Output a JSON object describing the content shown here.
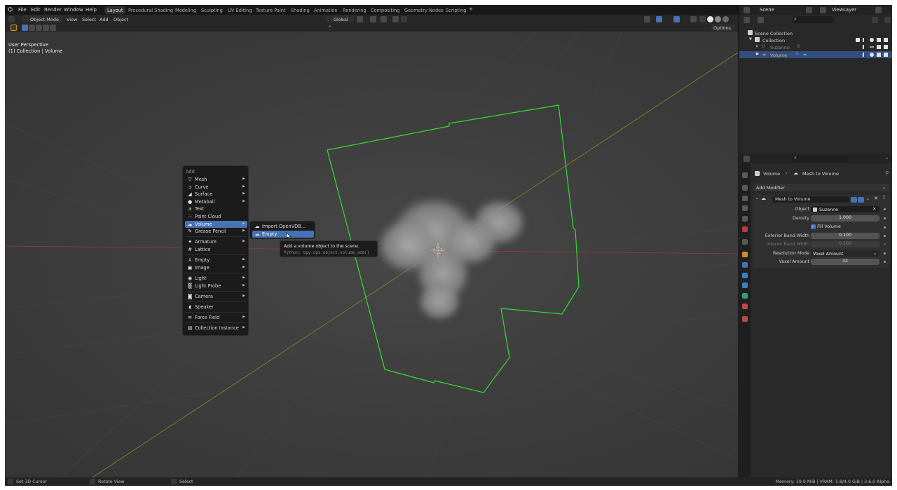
{
  "topbar": {
    "menus": [
      "File",
      "Edit",
      "Render",
      "Window",
      "Help"
    ],
    "workspaces": [
      "Layout",
      "Procedural Shading",
      "Modeling",
      "Sculpting",
      "UV Editing",
      "Texture Paint",
      "Shading",
      "Animation",
      "Rendering",
      "Compositing",
      "Geometry Nodes",
      "Scripting"
    ],
    "active_workspace": "Layout",
    "add_tab": "+",
    "scene": "Scene",
    "view_layer": "ViewLayer"
  },
  "viewport_header": {
    "mode": "Object Mode",
    "view": "View",
    "select": "Select",
    "add": "Add",
    "object": "Object",
    "orientation": "Global",
    "options": "Options"
  },
  "viewport": {
    "perspective": "User Perspective",
    "collection": "(1) Collection | Volume"
  },
  "add_menu": {
    "title": "Add",
    "items": [
      {
        "label": "Mesh",
        "icon": "▽",
        "sub": true
      },
      {
        "label": "Curve",
        "icon": "ↄ",
        "sub": true
      },
      {
        "label": "Surface",
        "icon": "◢",
        "sub": true
      },
      {
        "label": "Metaball",
        "icon": "●",
        "sub": true
      },
      {
        "label": "Text",
        "icon": "a",
        "sub": false
      },
      {
        "label": "Point Cloud",
        "icon": "⁘",
        "sub": false
      },
      {
        "label": "Volume",
        "icon": "☁",
        "sub": true
      },
      {
        "label": "Grease Pencil",
        "icon": "✎",
        "sub": true
      },
      {
        "label": "Armature",
        "icon": "✦",
        "sub": true
      },
      {
        "label": "Lattice",
        "icon": "#",
        "sub": false
      },
      {
        "label": "Empty",
        "icon": "⅄",
        "sub": true
      },
      {
        "label": "Image",
        "icon": "▣",
        "sub": true
      },
      {
        "label": "Light",
        "icon": "◉",
        "sub": true
      },
      {
        "label": "Light Probe",
        "icon": "▒",
        "sub": true
      },
      {
        "label": "Camera",
        "icon": "◙",
        "sub": true
      },
      {
        "label": "Speaker",
        "icon": "◖",
        "sub": false
      },
      {
        "label": "Force Field",
        "icon": "≋",
        "sub": true
      },
      {
        "label": "Collection Instance",
        "icon": "▤",
        "sub": true
      }
    ],
    "submenu": [
      {
        "label": "Import OpenVDB...",
        "icon": "☁"
      },
      {
        "label": "Empty",
        "icon": "☁"
      }
    ]
  },
  "tooltip": {
    "text": "Add a volume object to the scene.",
    "python": "Python: bpy.ops.object.volume_add()"
  },
  "statusbar": {
    "set_cursor": "Set 3D Cursor",
    "rotate": "Rotate View",
    "select": "Select",
    "memory": "Memory: 19.9 MiB | VRAM: 1.8/4.0 GiB | 3.6.0 Alpha"
  },
  "outliner": {
    "scene_collection": "Scene Collection",
    "collection": "Collection",
    "objects": [
      "Suzanne",
      "Volume"
    ]
  },
  "properties": {
    "breadcrumb_object": "Volume",
    "breadcrumb_modifier": "Mesh to Volume",
    "add_modifier": "Add Modifier",
    "modifier_name": "Mesh to Volume",
    "object_label": "Object",
    "object_value": "Suzanne",
    "density_label": "Density",
    "density_value": "1.000",
    "fill_volume": "Fill Volume",
    "ext_band_label": "Exterior Band Width",
    "ext_band_value": "0.100",
    "int_band_label": "Interior Band Width",
    "int_band_value": "0.100",
    "res_mode_label": "Resolution Mode",
    "res_mode_value": "Voxel Amount",
    "voxel_amount_label": "Voxel Amount",
    "voxel_amount_value": "32"
  },
  "colors": {
    "selection": "#4772b3",
    "bounding_box": "#33dd33",
    "x_axis": "#9b3a3a",
    "y_axis": "#7c8a2e"
  }
}
